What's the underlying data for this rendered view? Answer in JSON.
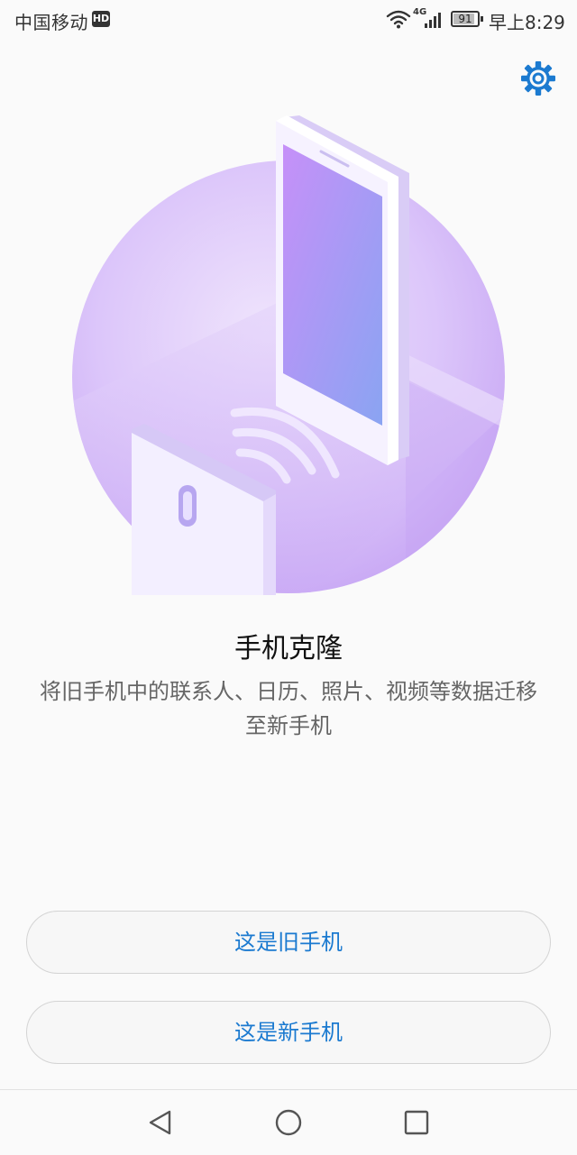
{
  "status_bar": {
    "carrier": "中国移动",
    "hd_badge": "HD",
    "network": "4G",
    "battery_level": "91",
    "time": "早上8:29"
  },
  "icons": {
    "settings": "gear-icon",
    "back": "back-triangle-icon",
    "home": "home-circle-icon",
    "recent": "recent-square-icon"
  },
  "main": {
    "title": "手机克隆",
    "description": "将旧手机中的联系人、日历、照片、视频等数据迁移至新手机"
  },
  "actions": {
    "old_phone_label": "这是旧手机",
    "new_phone_label": "这是新手机"
  },
  "colors": {
    "accent": "#1b7ad0",
    "hero_purple": "#c8a8f5",
    "background": "#fafafa"
  }
}
